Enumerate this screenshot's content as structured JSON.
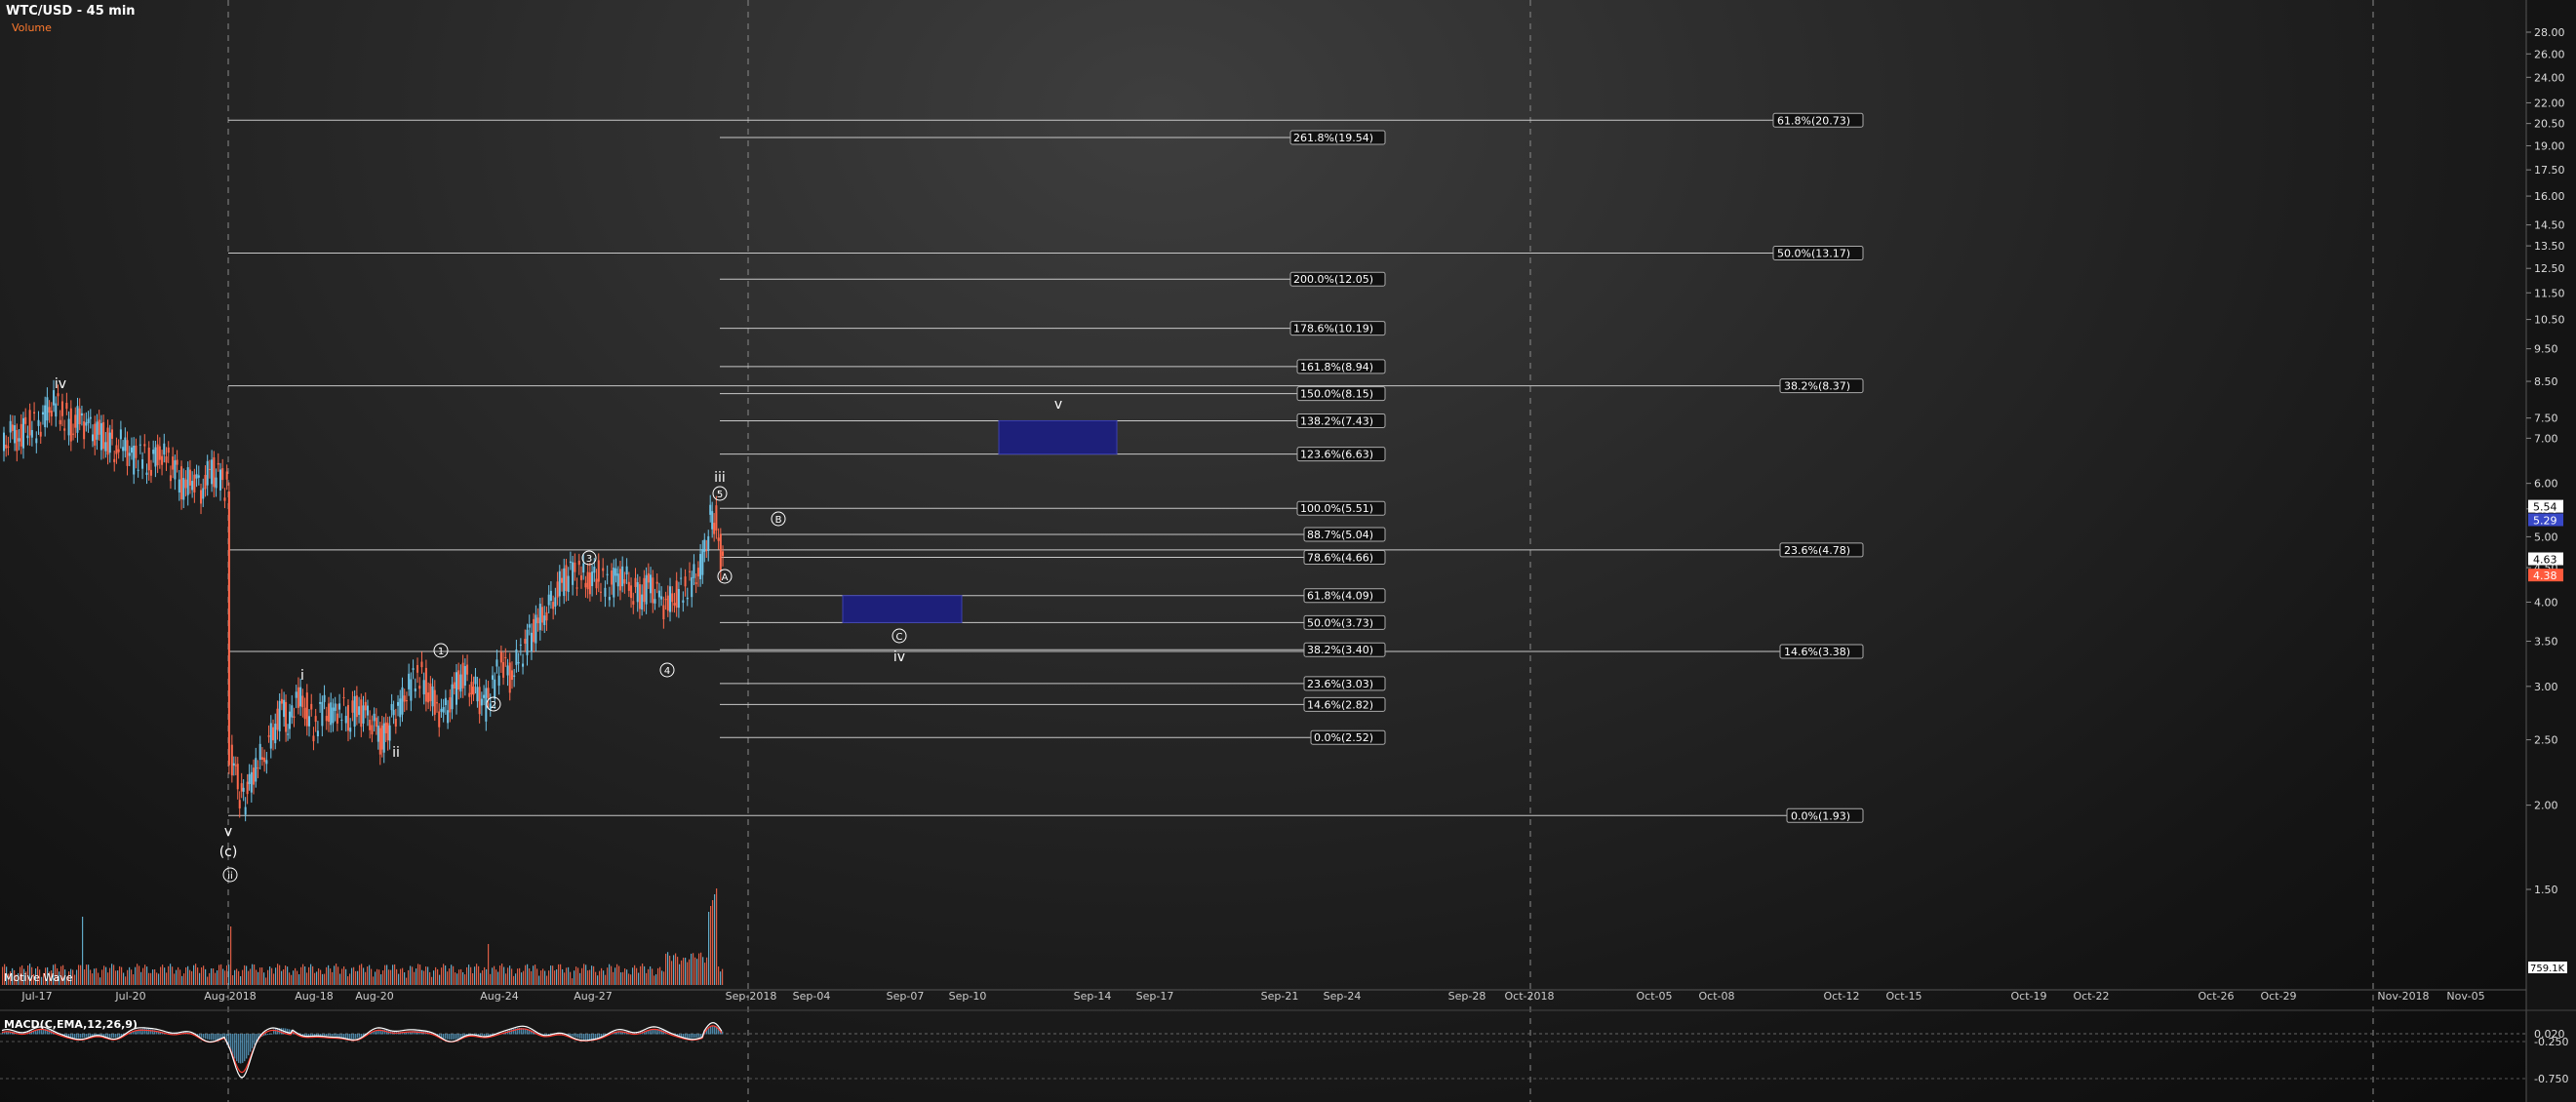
{
  "header": {
    "title": "WTC/USD - 45 min",
    "volume_label": "Volume"
  },
  "study_label": "Motive Wave",
  "colors": {
    "up": "#6ec4e8",
    "down": "#ff6a4d",
    "fib": "#c8c8c8",
    "box": "#1d1f7a",
    "price_up_tag": "#ffffff",
    "price_down_tag": "#ff5a3c",
    "macd_line": "#ffffff",
    "macd_signal": "#ff3b30",
    "macd_hist": "#5aa0c8"
  },
  "price_axis": {
    "scale": "log",
    "range": [
      1.3,
      30
    ],
    "ticks": [
      "28.00",
      "26.00",
      "24.00",
      "22.00",
      "20.50",
      "19.00",
      "17.50",
      "16.00",
      "14.50",
      "13.50",
      "12.50",
      "11.50",
      "10.50",
      "9.50",
      "8.50",
      "7.50",
      "7.00",
      "6.00",
      "5.50",
      "5.00",
      "4.50",
      "4.00",
      "3.50",
      "3.00",
      "2.50",
      "2.00",
      "1.50"
    ],
    "price_tags": [
      {
        "value": "5.54",
        "tone": "up"
      },
      {
        "value": "5.29",
        "tone": "blue"
      },
      {
        "value": "4.63",
        "tone": "up"
      },
      {
        "value": "4.38",
        "tone": "down"
      }
    ],
    "volume_tag": "759.1K"
  },
  "time_axis": {
    "labels": [
      "Jul-17",
      "Jul-20",
      "Aug-2018",
      "Aug-18",
      "Aug-20",
      "Aug-24",
      "Aug-27",
      "Sep-2018",
      "Sep-04",
      "Sep-07",
      "Sep-10",
      "Sep-14",
      "Sep-17",
      "Sep-21",
      "Sep-24",
      "Sep-28",
      "Oct-2018",
      "Oct-05",
      "Oct-08",
      "Oct-12",
      "Oct-15",
      "Oct-19",
      "Oct-22",
      "Oct-26",
      "Oct-29",
      "Nov-2018",
      "Nov-05"
    ]
  },
  "chart_data": {
    "type": "candlestick",
    "title": "WTC/USD - 45 min",
    "y_scale": "log",
    "ylim": [
      1.3,
      30
    ],
    "price_path": [
      [
        0,
        6.7
      ],
      [
        6,
        7.1
      ],
      [
        12,
        7.0
      ],
      [
        18,
        7.4
      ],
      [
        24,
        7.2
      ],
      [
        30,
        7.6
      ],
      [
        36,
        7.9
      ],
      [
        42,
        7.6
      ],
      [
        48,
        7.3
      ],
      [
        54,
        7.5
      ],
      [
        60,
        7.2
      ],
      [
        66,
        7.1
      ],
      [
        72,
        7.0
      ],
      [
        78,
        6.8
      ],
      [
        84,
        6.9
      ],
      [
        90,
        6.5
      ],
      [
        96,
        6.6
      ],
      [
        102,
        6.4
      ],
      [
        108,
        6.7
      ],
      [
        114,
        6.5
      ],
      [
        120,
        6.2
      ],
      [
        126,
        5.9
      ],
      [
        132,
        6.2
      ],
      [
        138,
        5.9
      ],
      [
        144,
        6.3
      ],
      [
        150,
        6.1
      ],
      [
        156,
        5.9
      ],
      [
        158,
        2.4
      ],
      [
        162,
        2.2
      ],
      [
        166,
        2.0
      ],
      [
        170,
        2.1
      ],
      [
        176,
        2.3
      ],
      [
        182,
        2.4
      ],
      [
        188,
        2.6
      ],
      [
        194,
        2.8
      ],
      [
        198,
        2.6
      ],
      [
        204,
        2.9
      ],
      [
        210,
        2.8
      ],
      [
        216,
        2.6
      ],
      [
        222,
        2.8
      ],
      [
        228,
        2.7
      ],
      [
        234,
        2.8
      ],
      [
        240,
        2.7
      ],
      [
        246,
        2.8
      ],
      [
        252,
        2.7
      ],
      [
        258,
        2.6
      ],
      [
        262,
        2.5
      ],
      [
        266,
        2.55
      ],
      [
        270,
        2.7
      ],
      [
        276,
        2.8
      ],
      [
        282,
        3.0
      ],
      [
        288,
        3.15
      ],
      [
        294,
        3.0
      ],
      [
        300,
        2.8
      ],
      [
        306,
        2.7
      ],
      [
        312,
        2.9
      ],
      [
        318,
        3.15
      ],
      [
        324,
        3.05
      ],
      [
        328,
        2.95
      ],
      [
        334,
        2.8
      ],
      [
        340,
        3.0
      ],
      [
        346,
        3.3
      ],
      [
        352,
        3.1
      ],
      [
        358,
        3.3
      ],
      [
        364,
        3.5
      ],
      [
        370,
        3.7
      ],
      [
        376,
        3.9
      ],
      [
        382,
        4.1
      ],
      [
        388,
        4.3
      ],
      [
        394,
        4.4
      ],
      [
        400,
        4.4
      ],
      [
        406,
        4.3
      ],
      [
        412,
        4.4
      ],
      [
        418,
        4.2
      ],
      [
        424,
        4.3
      ],
      [
        430,
        4.4
      ],
      [
        436,
        4.2
      ],
      [
        442,
        4.1
      ],
      [
        448,
        4.25
      ],
      [
        454,
        4.05
      ],
      [
        460,
        3.95
      ],
      [
        466,
        4.1
      ],
      [
        472,
        4.2
      ],
      [
        478,
        4.3
      ],
      [
        484,
        4.5
      ],
      [
        488,
        5.0
      ],
      [
        492,
        5.5
      ],
      [
        495,
        5.1
      ],
      [
        498,
        4.7
      ],
      [
        500,
        4.45
      ]
    ],
    "fib_levels_a": [
      {
        "label": "261.8%(19.54)",
        "price": 19.54
      },
      {
        "label": "200.0%(12.05)",
        "price": 12.05
      },
      {
        "label": "178.6%(10.19)",
        "price": 10.19
      },
      {
        "label": "161.8%(8.94)",
        "price": 8.94
      },
      {
        "label": "150.0%(8.15)",
        "price": 8.15
      },
      {
        "label": "138.2%(7.43)",
        "price": 7.43
      },
      {
        "label": "123.6%(6.63)",
        "price": 6.63
      },
      {
        "label": "100.0%(5.51)",
        "price": 5.51
      },
      {
        "label": "88.7%(5.04)",
        "price": 5.04
      },
      {
        "label": "78.6%(4.66)",
        "price": 4.66
      },
      {
        "label": "61.8%(4.09)",
        "price": 4.09
      },
      {
        "label": "50.0%(3.73)",
        "price": 3.73
      },
      {
        "label": "38.2%(3.40)",
        "price": 3.4
      },
      {
        "label": "23.6%(3.03)",
        "price": 3.03
      },
      {
        "label": "14.6%(2.82)",
        "price": 2.82
      },
      {
        "label": "0.0%(2.52)",
        "price": 2.52
      }
    ],
    "fib_levels_b": [
      {
        "label": "61.8%(20.73)",
        "price": 20.73
      },
      {
        "label": "50.0%(13.17)",
        "price": 13.17
      },
      {
        "label": "38.2%(8.37)",
        "price": 8.37
      },
      {
        "label": "23.6%(4.78)",
        "price": 4.78
      },
      {
        "label": "14.6%(3.38)",
        "price": 3.38
      },
      {
        "label": "0.0%(1.93)",
        "price": 1.93
      }
    ],
    "target_boxes": [
      {
        "from": "Sep-11",
        "to": "Sep-14",
        "low": 6.63,
        "high": 7.43,
        "label": "v"
      },
      {
        "from": "Sep-05",
        "to": "Sep-08",
        "low": 3.73,
        "high": 4.09,
        "label": "iv"
      }
    ],
    "wave_labels": [
      {
        "text": "iv",
        "price": 8.9,
        "style": "roman"
      },
      {
        "text": "v",
        "price": 1.93,
        "style": "roman"
      },
      {
        "text": "c",
        "price": 1.82,
        "style": "paren"
      },
      {
        "text": "ii",
        "price": 1.7,
        "style": "circled"
      },
      {
        "text": "i",
        "price": 3.0,
        "style": "roman"
      },
      {
        "text": "ii",
        "price": 2.45,
        "style": "roman"
      },
      {
        "text": "1",
        "price": 3.38,
        "style": "circled"
      },
      {
        "text": "2",
        "price": 2.72,
        "style": "circled"
      },
      {
        "text": "3",
        "price": 4.58,
        "style": "circled"
      },
      {
        "text": "4",
        "price": 3.7,
        "style": "circled"
      },
      {
        "text": "5",
        "price": 5.65,
        "style": "circled"
      },
      {
        "text": "iii",
        "price": 5.95,
        "style": "roman"
      },
      {
        "text": "B",
        "price": 5.25,
        "style": "circled"
      },
      {
        "text": "A",
        "price": 4.3,
        "style": "circled"
      },
      {
        "text": "C",
        "price": 3.52,
        "style": "circled"
      },
      {
        "text": "iv",
        "price": 3.3,
        "style": "roman"
      },
      {
        "text": "v",
        "price": 7.95,
        "style": "roman"
      }
    ],
    "macd": {
      "label": "MACD(C,EMA,12,26,9)",
      "ticks": [
        "0.020",
        "-0.250",
        "-0.750"
      ]
    }
  }
}
